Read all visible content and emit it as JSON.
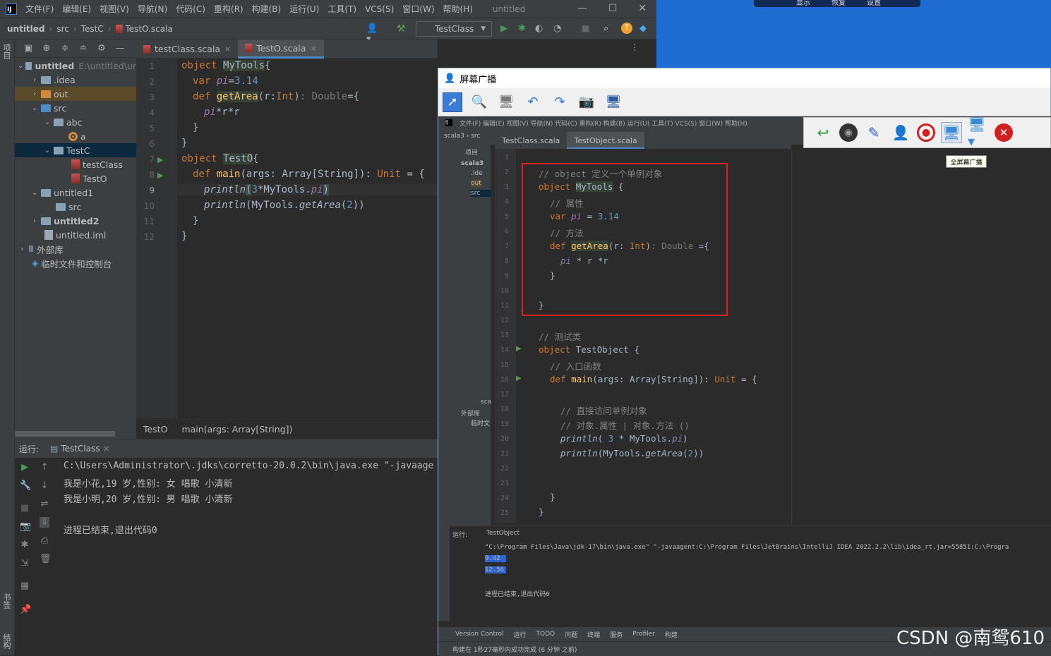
{
  "menubar": {
    "logo": "IJ",
    "items": [
      "文件(F)",
      "编辑(E)",
      "视图(V)",
      "导航(N)",
      "代码(C)",
      "重构(R)",
      "构建(B)",
      "运行(U)",
      "工具(T)",
      "VCS(S)",
      "窗口(W)",
      "帮助(H)"
    ],
    "title": "untitled"
  },
  "navbar": {
    "crumbs": [
      "untitled",
      "src",
      "TestC",
      "TestO.scala"
    ],
    "run_config": "TestClass"
  },
  "left_strip": {
    "project_label": "项目",
    "bookmarks_label": "书签",
    "structure_label": "结构"
  },
  "project_tree": [
    {
      "label": "untitled",
      "extra": "E:\\untitled\\ur",
      "depth": 0
    },
    {
      "label": ".idea",
      "depth": 1
    },
    {
      "label": "out",
      "depth": 1
    },
    {
      "label": "src",
      "depth": 1
    },
    {
      "label": "abc",
      "depth": 2
    },
    {
      "label": "a",
      "depth": 3
    },
    {
      "label": "TestC",
      "depth": 2
    },
    {
      "label": "testClass",
      "depth": 3
    },
    {
      "label": "TestO",
      "depth": 3
    },
    {
      "label": "untitled1",
      "depth": 1
    },
    {
      "label": "src",
      "depth": 2
    },
    {
      "label": "untitled2",
      "depth": 1
    },
    {
      "label": "untitled.iml",
      "depth": 1
    },
    {
      "label": "外部库",
      "depth": 0
    },
    {
      "label": "临时文件和控制台",
      "depth": 0
    }
  ],
  "editor": {
    "tabs": [
      "testClass.scala",
      "TestO.scala"
    ],
    "line_numbers": [
      "1",
      "2",
      "3",
      "4",
      "5",
      "6",
      "7",
      "8",
      "9",
      "10",
      "11",
      "12"
    ],
    "breadcrumb": [
      "TestO",
      "main(args: Array[String])"
    ]
  },
  "run_panel": {
    "label": "运行:",
    "tab": "TestClass",
    "output": [
      "C:\\Users\\Administrator\\.jdks\\corretto-20.0.2\\bin\\java.exe \"-javaage",
      "我是小花,19 岁,性别: 女 唱歌 小清新",
      "我是小明,20 岁,性别: 男 唱歌 小清新",
      "",
      "进程已结束,退出代码0"
    ]
  },
  "desktop_bar": [
    "显示",
    "恢复",
    "设置"
  ],
  "broadcast": {
    "title": "屏幕广播",
    "tooltip": "全屏幕广播",
    "inner_menu": "文件(F)  编辑(E)  视图(V)  导航(N)  代码(C)  重构(R)  构建(B)  运行(U)  工具(T)  VCS(S)  窗口(W)  帮助(H)",
    "inner_crumbs": "scala3 › src",
    "inner_tabs": [
      "TestClass.scala",
      "TestObject.scala"
    ],
    "inner_tree_header": "项目",
    "inner_tree": [
      "scala3",
      ".ide",
      "out",
      "src",
      "sca",
      "外部库",
      "临时文"
    ],
    "inner_lines": [
      "1",
      "2",
      "3",
      "4",
      "5",
      "6",
      "7",
      "8",
      "9",
      "10",
      "11",
      "12",
      "13",
      "14",
      "15",
      "16",
      "17",
      "18",
      "19",
      "20",
      "21",
      "22",
      "23",
      "24",
      "25"
    ],
    "inner_run_label": "运行:",
    "inner_run_tab": "TestObject",
    "inner_output": [
      "\"C:\\Program Files\\Java\\jdk-17\\bin\\java.exe\" \"-javaagent:C:\\Program Files\\JetBrains\\IntelliJ IDEA 2022.2.2\\lib\\idea_rt.jar=55851:C:\\Progra",
      "9.42",
      "12.56",
      "",
      "进程已结束,退出代码0"
    ],
    "inner_statusbar": [
      "Version Control",
      "运行",
      "TODO",
      "问题",
      "终端",
      "服务",
      "Profiler",
      "构建"
    ],
    "inner_status_msg": "构建在 1秒27毫秒内成功完成 (6 分钟 之前)"
  },
  "watermark": "CSDN @南鸳610"
}
